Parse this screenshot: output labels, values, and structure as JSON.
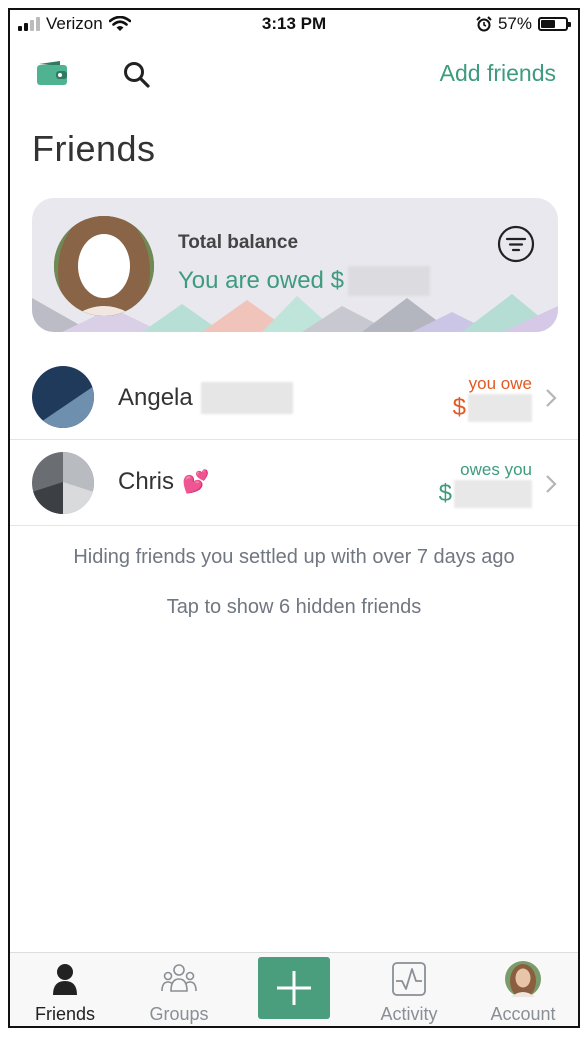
{
  "status": {
    "carrier": "Verizon",
    "time": "3:13 PM",
    "battery": "57%",
    "battery_level": 0.57
  },
  "nav": {
    "add_friends": "Add friends"
  },
  "page": {
    "title": "Friends"
  },
  "balance": {
    "label": "Total balance",
    "owed_text": "You are owed $"
  },
  "friends": [
    {
      "name": "Angela",
      "balance_label": "you owe",
      "currency": "$",
      "emoji": ""
    },
    {
      "name": "Chris",
      "balance_label": "owes you",
      "currency": "$",
      "emoji": "💕"
    }
  ],
  "hints": {
    "hiding": "Hiding friends you settled up with over 7 days ago",
    "show_hidden": "Tap to show 6 hidden friends"
  },
  "tabs": [
    {
      "label": "Friends",
      "icon": "person-icon",
      "active": true
    },
    {
      "label": "Groups",
      "icon": "groups-icon",
      "active": false
    },
    {
      "label": "",
      "icon": "plus-icon",
      "active": false
    },
    {
      "label": "Activity",
      "icon": "activity-icon",
      "active": false
    },
    {
      "label": "Account",
      "icon": "avatar-icon",
      "active": false
    }
  ],
  "colors": {
    "accent_green": "#3e9b7e",
    "owe_orange": "#e05a23",
    "plus_button": "#4a9e7e"
  }
}
